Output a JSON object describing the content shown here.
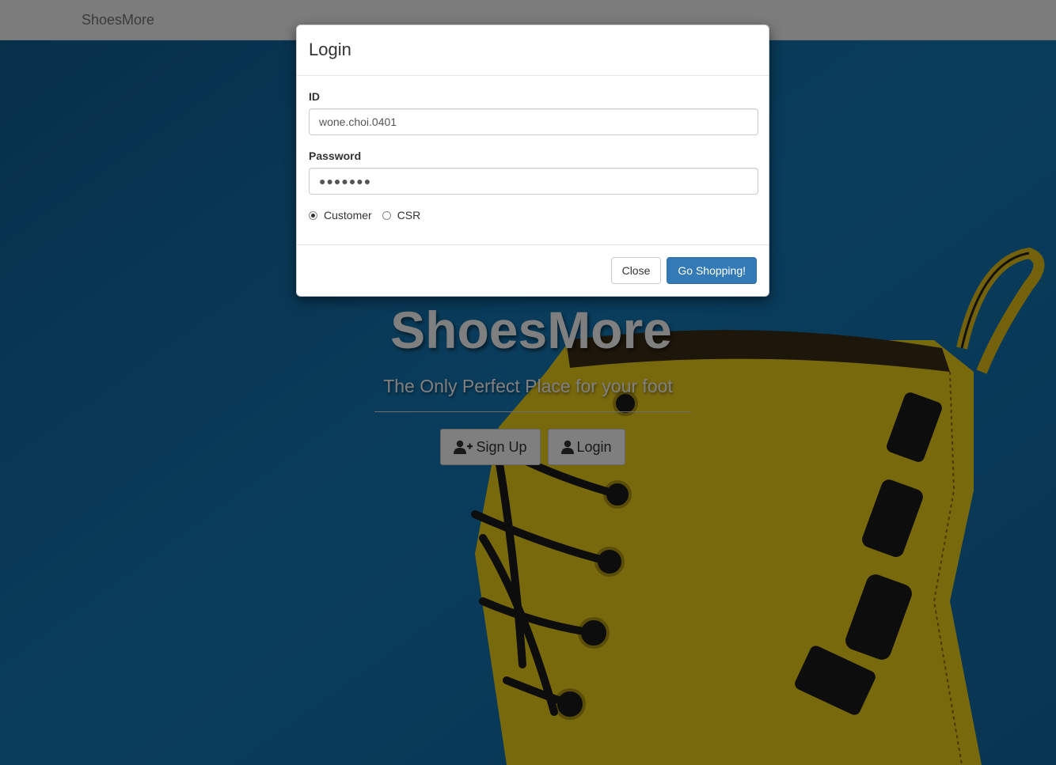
{
  "colors": {
    "background_blue": "#1479b8",
    "boot_yellow": "#f2d21b",
    "primary_button": "#337ab7"
  },
  "navbar": {
    "brand": "ShoesMore"
  },
  "hero": {
    "title": "ShoesMore",
    "subtitle": "The Only Perfect Place for your foot",
    "signup_label": "Sign Up",
    "login_label": "Login",
    "signup_icon": "user-plus-icon",
    "login_icon": "user-icon"
  },
  "login_modal": {
    "title": "Login",
    "id_label": "ID",
    "id_value": "wone.choi.0401",
    "password_label": "Password",
    "password_value": "●●●●●●●",
    "role_options": [
      {
        "label": "Customer",
        "selected": true
      },
      {
        "label": "CSR",
        "selected": false
      }
    ],
    "close_label": "Close",
    "submit_label": "Go Shopping!"
  }
}
